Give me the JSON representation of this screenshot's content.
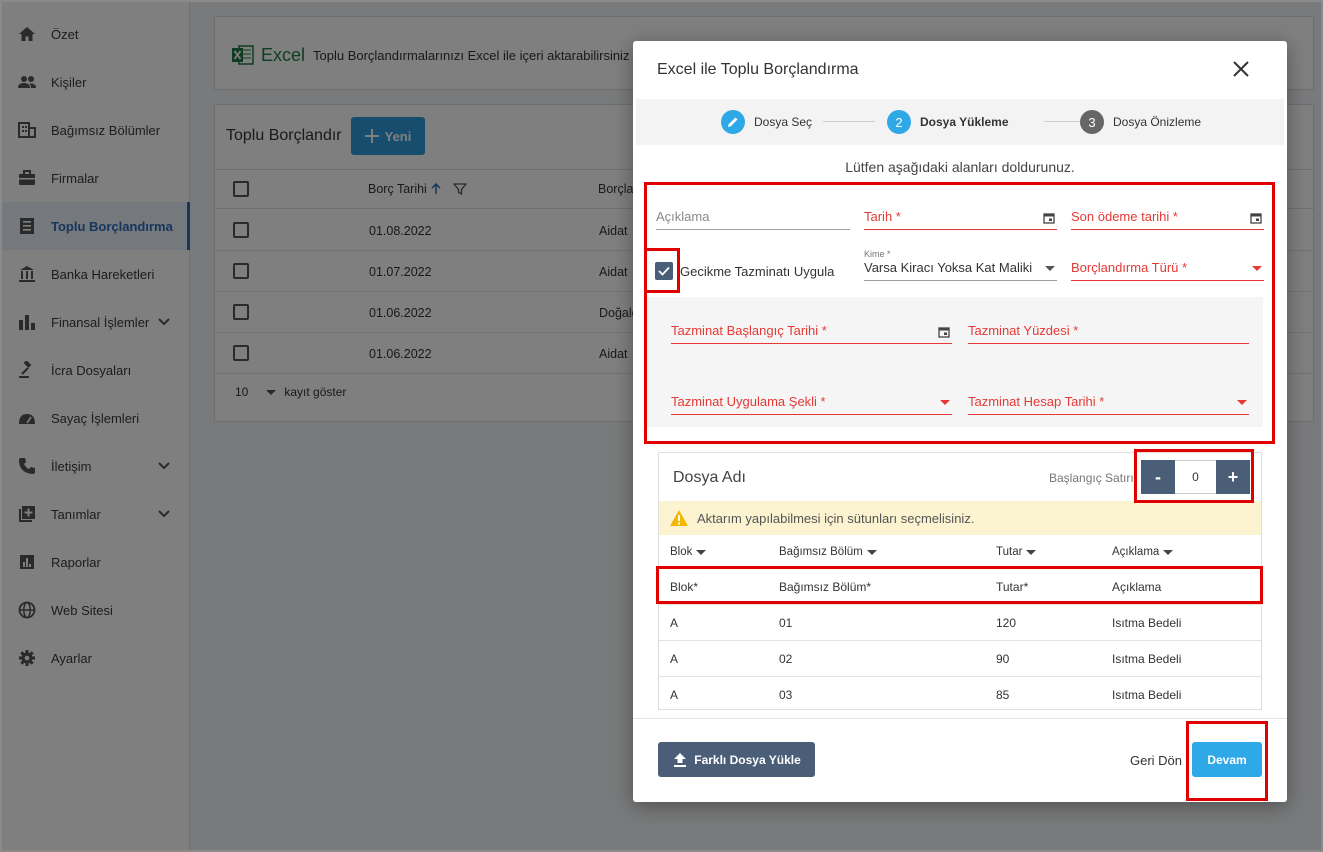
{
  "sidebar": {
    "items": [
      {
        "label": "Özet",
        "icon": "home-icon"
      },
      {
        "label": "Kişiler",
        "icon": "people-icon"
      },
      {
        "label": "Bağımsız Bölümler",
        "icon": "building-icon"
      },
      {
        "label": "Firmalar",
        "icon": "briefcase-icon"
      },
      {
        "label": "Toplu Borçlandırma",
        "icon": "receipt-icon",
        "active": true
      },
      {
        "label": "Banka Hareketleri",
        "icon": "bank-icon"
      },
      {
        "label": "Finansal İşlemler",
        "icon": "bar-chart-icon",
        "has_children": true
      },
      {
        "label": "İcra Dosyaları",
        "icon": "gavel-icon"
      },
      {
        "label": "Sayaç İşlemleri",
        "icon": "meter-icon"
      },
      {
        "label": "İletişim",
        "icon": "phone-icon",
        "has_children": true
      },
      {
        "label": "Tanımlar",
        "icon": "add-box-icon",
        "has_children": true
      },
      {
        "label": "Raporlar",
        "icon": "report-icon"
      },
      {
        "label": "Web Sitesi",
        "icon": "globe-icon"
      },
      {
        "label": "Ayarlar",
        "icon": "gear-icon"
      }
    ]
  },
  "banner": {
    "excel_word": "Excel",
    "text": "Toplu Borçlandırmalarınızı Excel ile içeri aktarabilirsiniz"
  },
  "list": {
    "title": "Toplu Borçlandır",
    "new_label": "Yeni",
    "col_date": "Borç Tarihi",
    "col_type": "Borçlan",
    "rows": [
      {
        "date": "01.08.2022",
        "type": "Aidat"
      },
      {
        "date": "01.07.2022",
        "type": "Aidat"
      },
      {
        "date": "01.06.2022",
        "type": "Doğalg"
      },
      {
        "date": "01.06.2022",
        "type": "Aidat"
      }
    ],
    "page_size": "10",
    "page_size_label": "kayıt göster"
  },
  "modal": {
    "title": "Excel ile Toplu Borçlandırma",
    "steps": [
      {
        "number": "",
        "label": "Dosya Seç",
        "state": "done",
        "color": "#2ea8e6"
      },
      {
        "number": "2",
        "label": "Dosya Yükleme",
        "state": "active",
        "color": "#2ea8e6"
      },
      {
        "number": "3",
        "label": "Dosya Önizleme",
        "state": "pending",
        "color": "#666666"
      }
    ],
    "instruction": "Lütfen aşağıdaki alanları doldurunuz.",
    "form": {
      "aciklama_label": "Açıklama",
      "tarih_label": "Tarih *",
      "son_odeme_label": "Son ödeme tarihi *",
      "gecikme_label": "Gecikme Tazminatı Uygula",
      "gecikme_checked": true,
      "kime_label": "Kime *",
      "kime_value": "Varsa Kiracı Yoksa Kat Maliki",
      "borclandirma_turu_label": "Borçlandırma Türü *",
      "taz_baslangic_label": "Tazminat Başlangıç Tarihi *",
      "taz_yuzde_label": "Tazminat Yüzdesi *",
      "taz_uygulama_label": "Tazminat Uygulama Şekli *",
      "taz_hesap_label": "Tazminat Hesap Tarihi *"
    },
    "file": {
      "name_label": "Dosya Adı",
      "start_row_label": "Başlangıç Satırı",
      "start_row_value": "0",
      "minus": "-",
      "plus": "+",
      "warning": "Aktarım yapılabilmesi için sütunları seçmelisiniz.",
      "columns": [
        "Blok",
        "Bağımsız Bölüm",
        "Tutar",
        "Açıklama"
      ],
      "rows": [
        [
          "Blok*",
          "Bağımsız Bölüm*",
          "Tutar*",
          "Açıklama"
        ],
        [
          "A",
          "01",
          "120",
          "Isıtma Bedeli"
        ],
        [
          "A",
          "02",
          "90",
          "Isıtma Bedeli"
        ],
        [
          "A",
          "03",
          "85",
          "Isıtma Bedeli"
        ]
      ]
    },
    "upload_label": "Farklı Dosya Yükle",
    "back_label": "Geri Dön",
    "next_label": "Devam"
  },
  "colors": {
    "accent": "#2ea8e6",
    "slate_button": "#4a5e78",
    "required_red": "#e53935",
    "highlight_red": "#e00000",
    "sidebar_active": "#2a6fb9"
  }
}
